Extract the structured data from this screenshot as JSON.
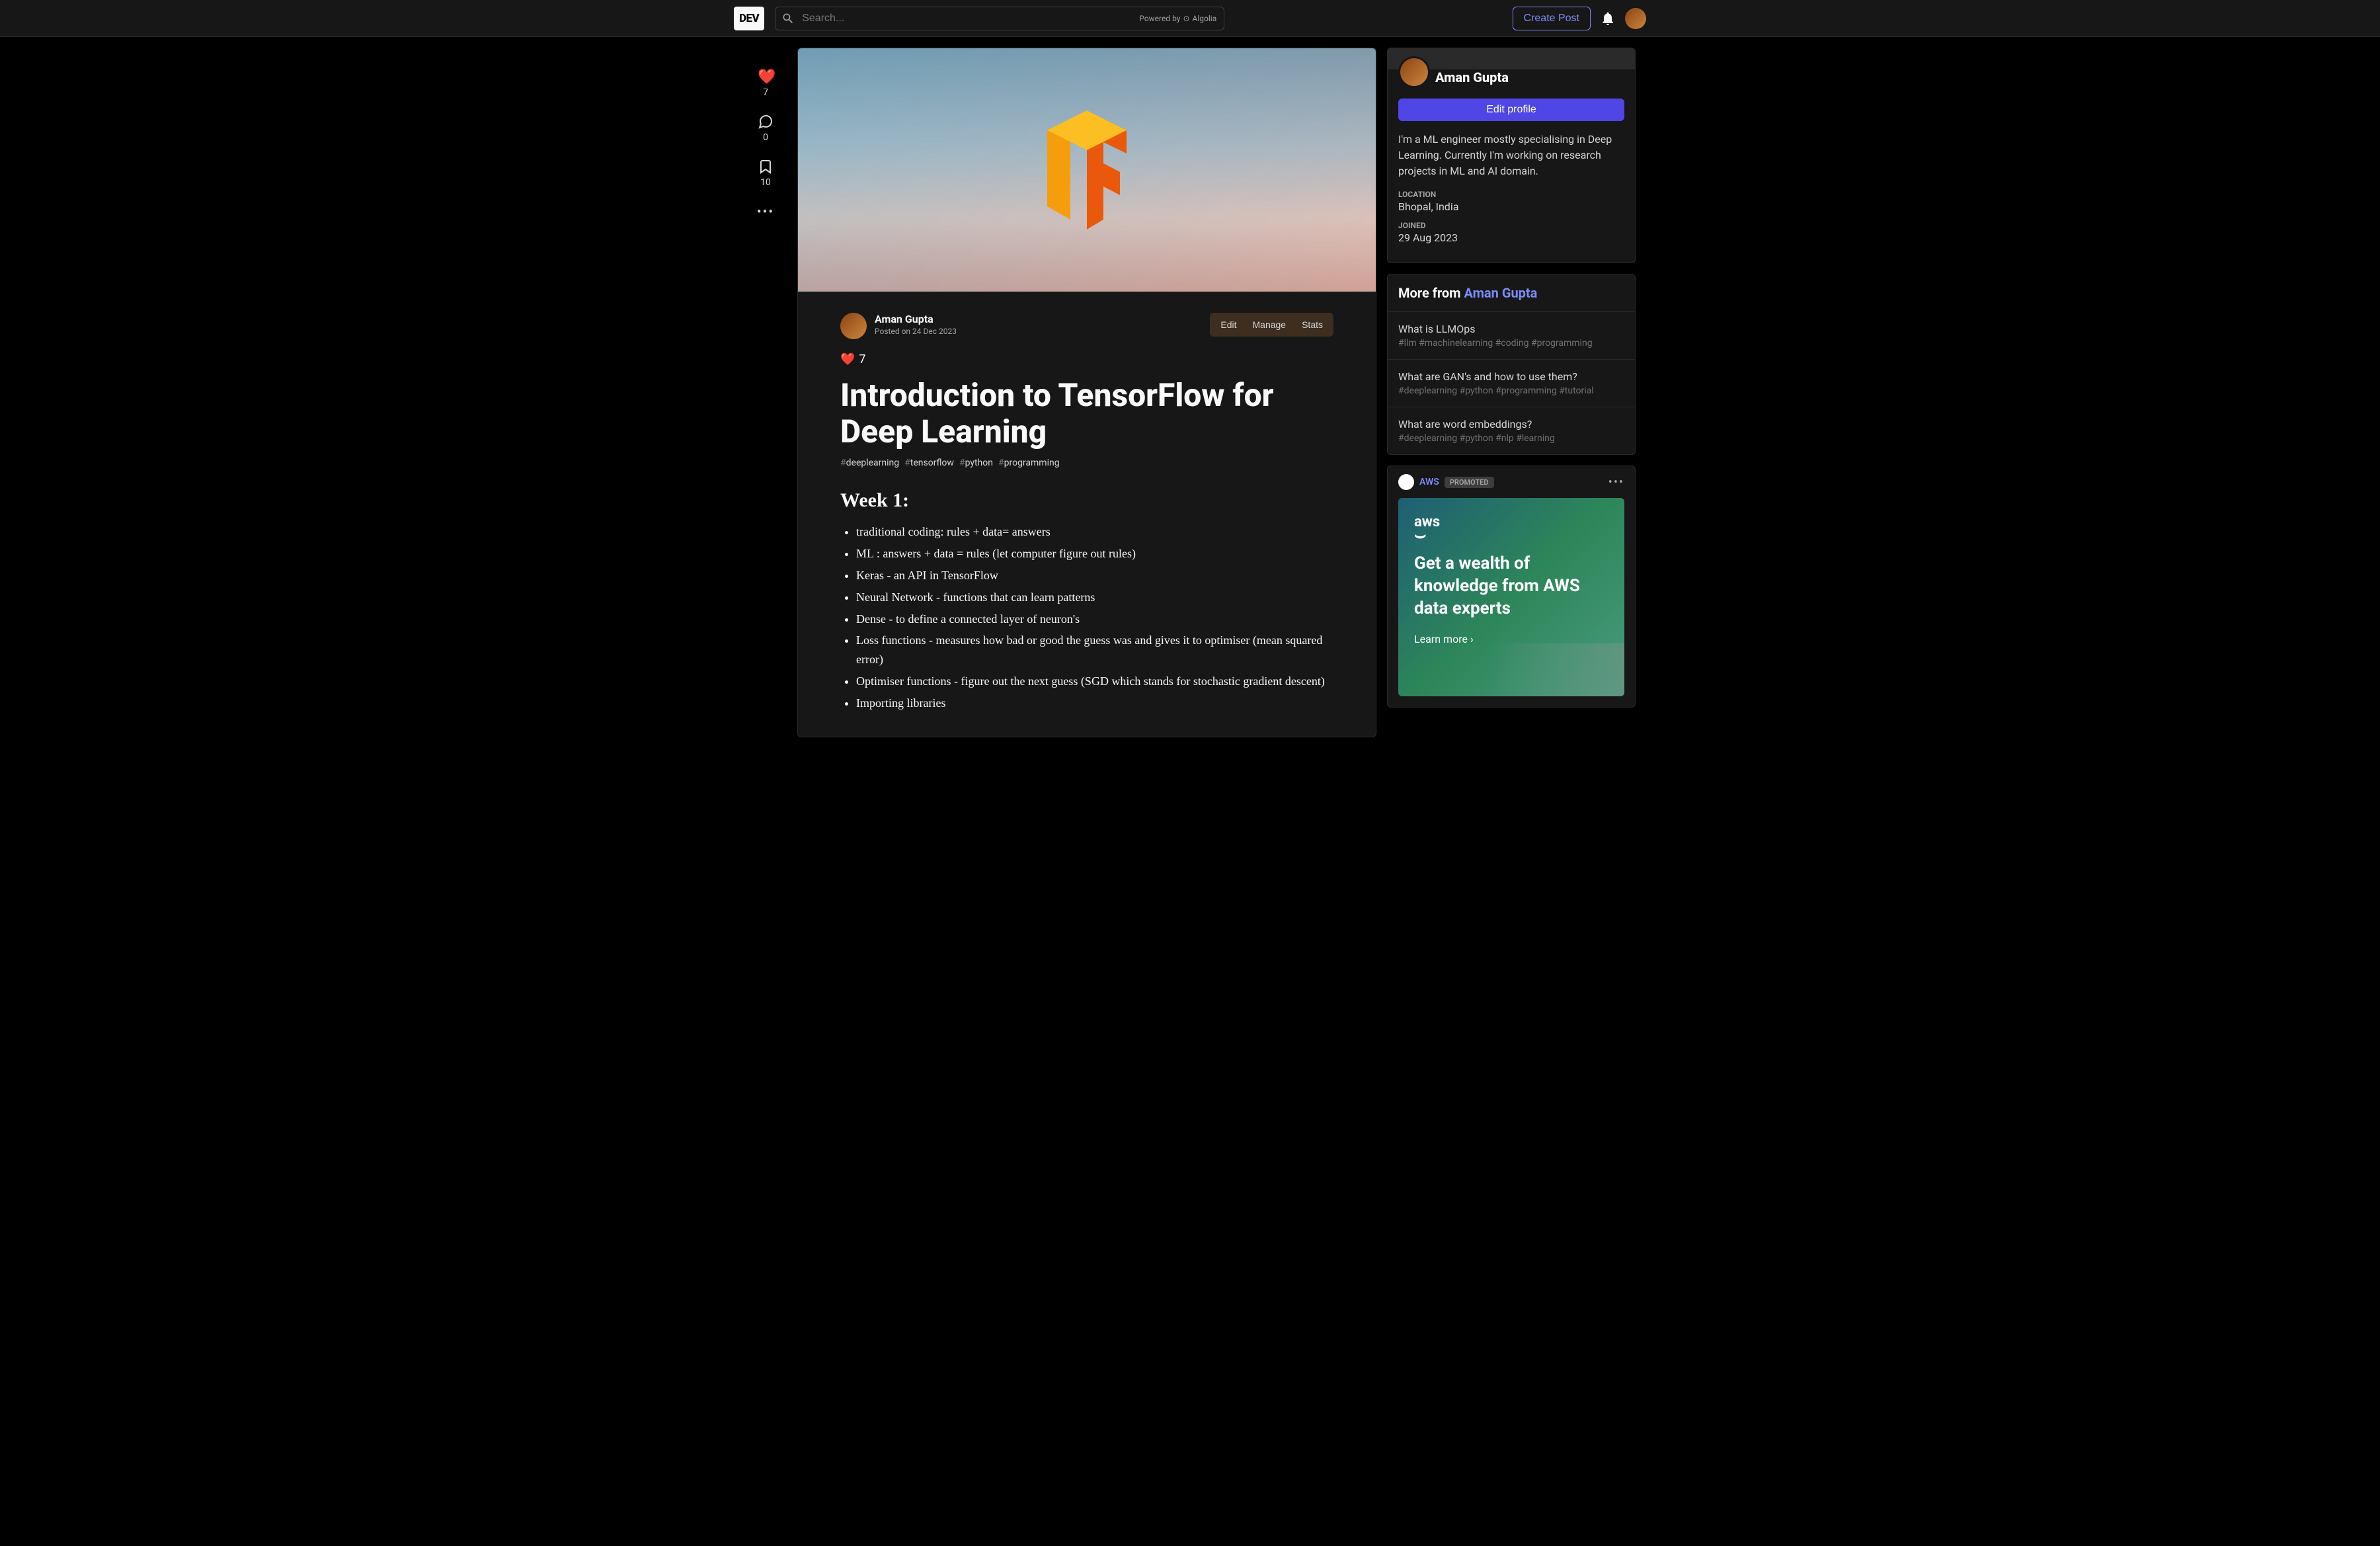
{
  "header": {
    "logo": "DEV",
    "search_placeholder": "Search...",
    "powered_by": "Powered by",
    "algolia": "Algolia",
    "create_post": "Create Post"
  },
  "rail": {
    "reactions": "7",
    "comments": "0",
    "bookmarks": "10"
  },
  "article": {
    "author": "Aman Gupta",
    "posted_prefix": "Posted on ",
    "posted_date": "24 Dec 2023",
    "edit": "Edit",
    "manage": "Manage",
    "stats": "Stats",
    "reaction_emoji": "❤️",
    "reaction_count": "7",
    "title": "Introduction to TensorFlow for Deep Learning",
    "tags": [
      "deeplearning",
      "tensorflow",
      "python",
      "programming"
    ],
    "tag_colors": [
      "#d6d6d7",
      "#d6d6d7",
      "#4584b6",
      "#d6d6d7"
    ],
    "h2": "Week 1:",
    "bullets": [
      "traditional coding: rules + data= answers",
      "ML : answers + data = rules (let computer figure out rules)",
      "Keras - an API in TensorFlow",
      "Neural Network - functions that can learn patterns",
      "Dense - to define a connected layer of neuron's",
      "Loss functions - measures how bad or good the guess was and gives it to optimiser (mean squared error)",
      "Optimiser functions - figure out the next guess (SGD which stands for stochastic gradient descent)",
      "Importing libraries"
    ]
  },
  "profile": {
    "name": "Aman Gupta",
    "edit_btn": "Edit profile",
    "bio": "I'm a ML engineer mostly specialising in Deep Learning. Currently I'm working on research projects in ML and AI domain.",
    "location_label": "LOCATION",
    "location": "Bhopal, India",
    "joined_label": "JOINED",
    "joined": "29 Aug 2023"
  },
  "more": {
    "prefix": "More from ",
    "author": "Aman Gupta",
    "items": [
      {
        "title": "What is LLMOps",
        "tags": "#llm  #machinelearning  #coding  #programming"
      },
      {
        "title": "What are GAN's and how to use them?",
        "tags": "#deeplearning  #python  #programming  #tutorial"
      },
      {
        "title": "What are word embeddings?",
        "tags": "#deeplearning  #python  #nlp  #learning"
      }
    ]
  },
  "promo": {
    "brand": "AWS",
    "badge": "PROMOTED",
    "logo_text": "aws",
    "headline": "Get a wealth of knowledge from AWS data experts",
    "cta": "Learn more ›"
  }
}
